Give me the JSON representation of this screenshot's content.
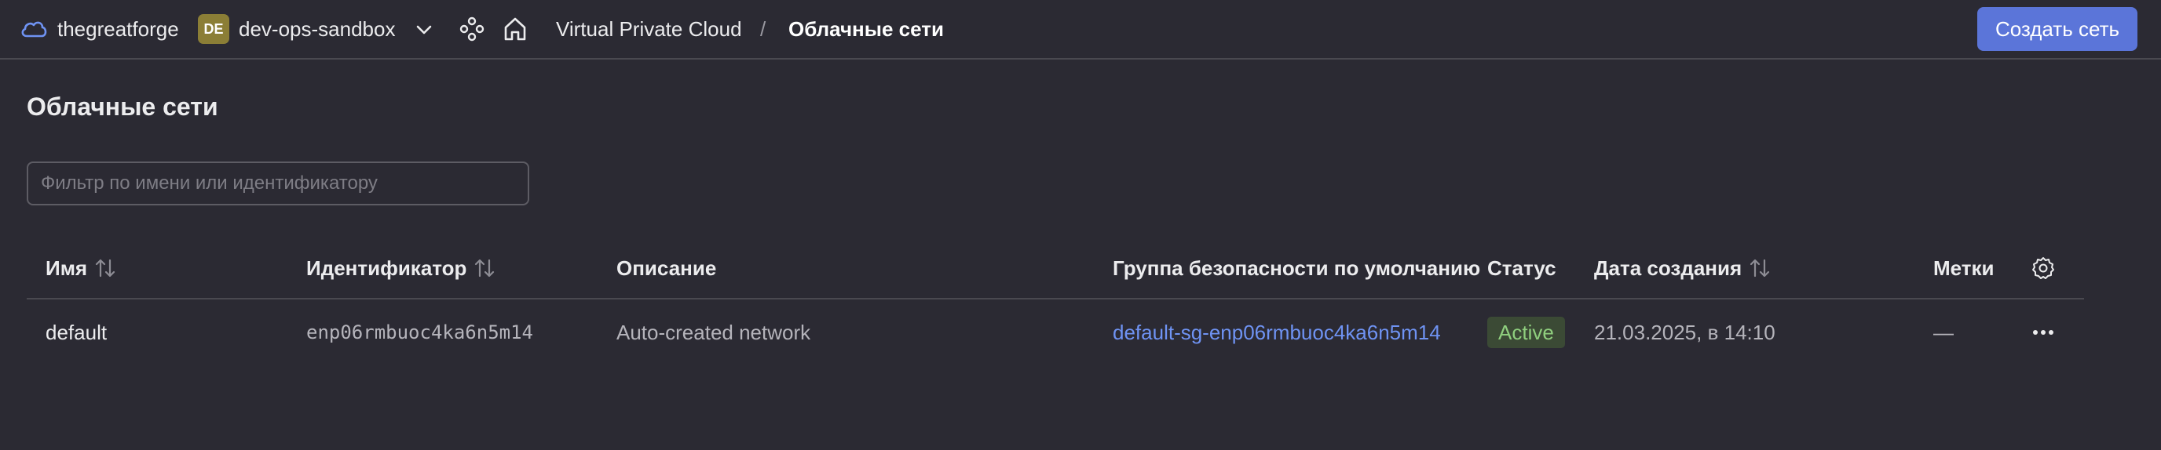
{
  "topbar": {
    "org_name": "thegreatforge",
    "folder_badge": "DE",
    "folder_name": "dev-ops-sandbox",
    "breadcrumb": [
      "Virtual Private Cloud",
      "/",
      "Облачные сети"
    ],
    "create_button": "Создать сеть"
  },
  "page": {
    "title": "Облачные сети",
    "filter_placeholder": "Фильтр по имени или идентификатору"
  },
  "table": {
    "columns": [
      "Имя",
      "Идентификатор",
      "Описание",
      "Группа безопасности по умолчанию",
      "Статус",
      "Дата создания",
      "Метки"
    ],
    "rows": [
      {
        "name": "default",
        "id": "enp06rmbuoc4ka6n5m14",
        "description": "Auto-created network",
        "security_group": "default-sg-enp06rmbuoc4ka6n5m14",
        "status": "Active",
        "created": "21.03.2025, в 14:10",
        "labels": "—"
      }
    ]
  },
  "colors": {
    "background": "#2b2a33",
    "accent": "#5b75d9",
    "link": "#6f93f3",
    "status_active": "#8fcf7e"
  },
  "icons": [
    "cloud-icon",
    "chevron-down-icon",
    "services-icon",
    "home-icon",
    "sort-icon",
    "gear-icon",
    "more-icon"
  ]
}
